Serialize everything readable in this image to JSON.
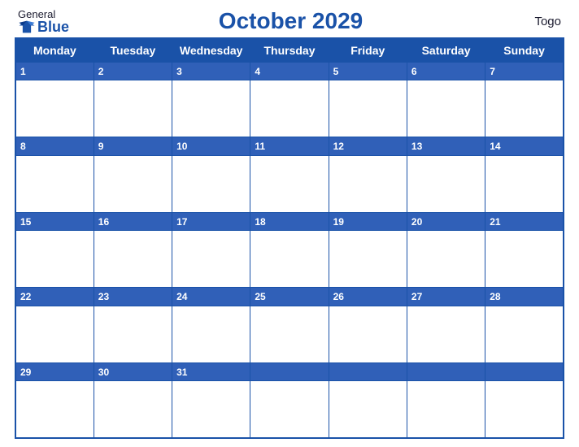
{
  "logo": {
    "general": "General",
    "blue": "Blue"
  },
  "title": "October 2029",
  "country": "Togo",
  "days_of_week": [
    "Monday",
    "Tuesday",
    "Wednesday",
    "Thursday",
    "Friday",
    "Saturday",
    "Sunday"
  ],
  "weeks": [
    [
      1,
      2,
      3,
      4,
      5,
      6,
      7
    ],
    [
      8,
      9,
      10,
      11,
      12,
      13,
      14
    ],
    [
      15,
      16,
      17,
      18,
      19,
      20,
      21
    ],
    [
      22,
      23,
      24,
      25,
      26,
      27,
      28
    ],
    [
      29,
      30,
      31,
      null,
      null,
      null,
      null
    ]
  ]
}
